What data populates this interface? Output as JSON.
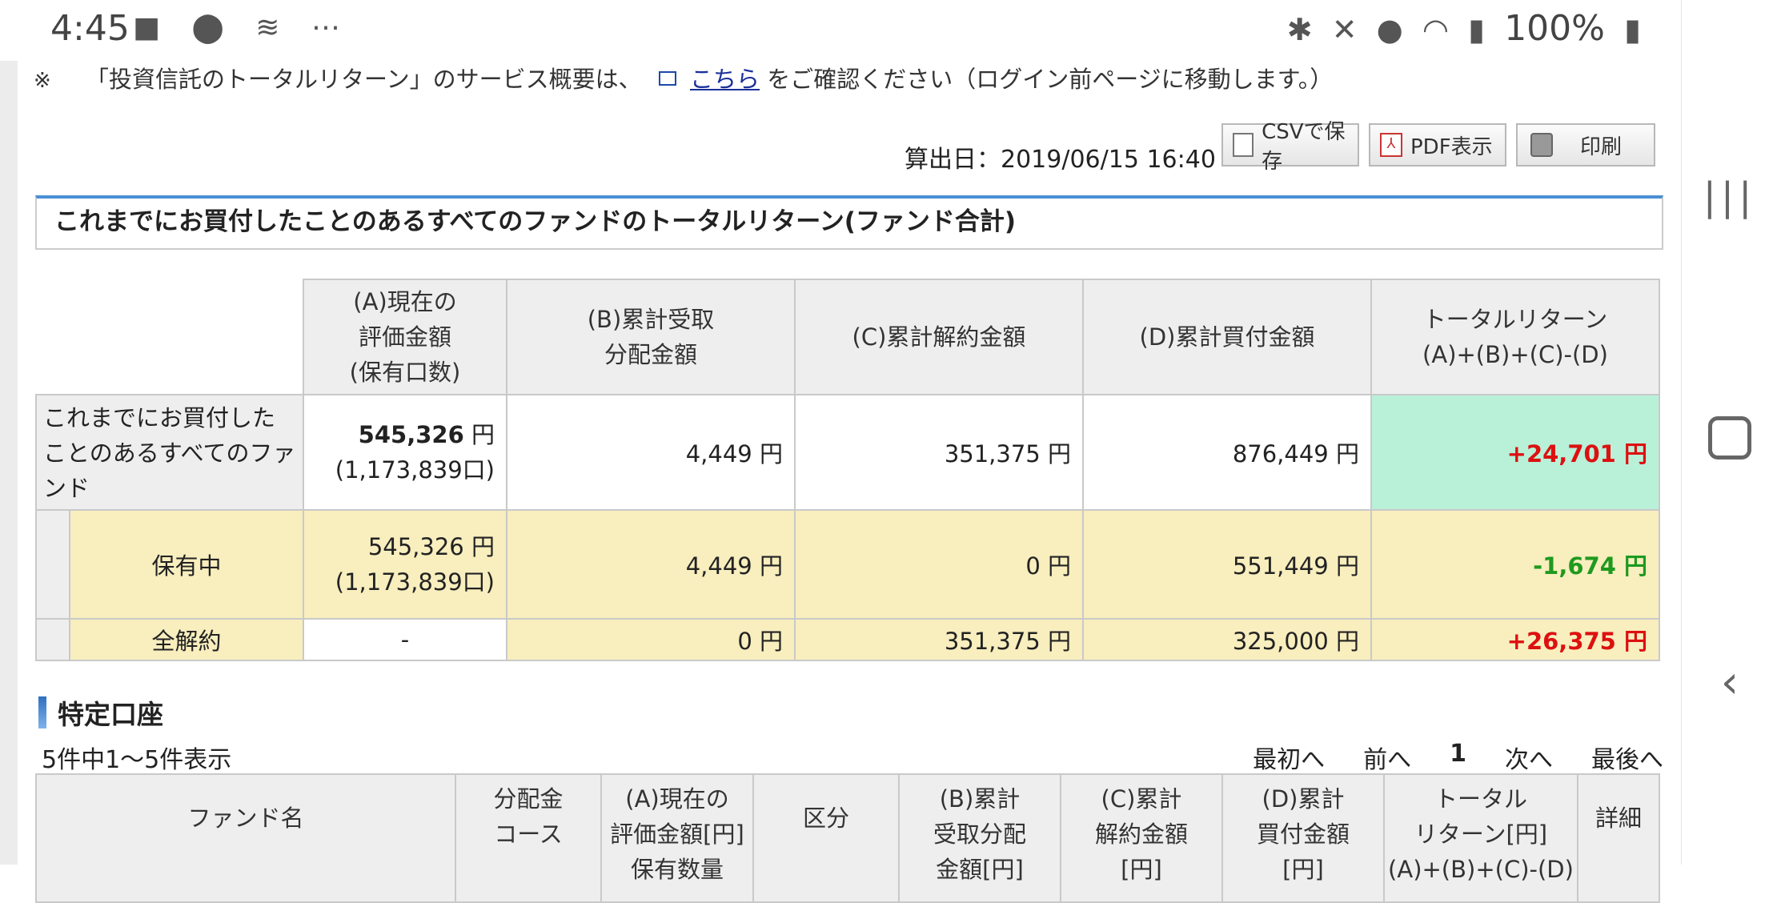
{
  "status_bar": {
    "time": "4:45",
    "left_icons": [
      "video-icon",
      "location-icon",
      "app-icon",
      "more-icon"
    ],
    "right_icons": [
      "bluetooth-icon",
      "mute-icon",
      "location-icon",
      "wifi-icon",
      "signal-icon"
    ],
    "battery": "100%"
  },
  "notice": {
    "mark": "※",
    "before": "「投資信託のトータルリターン」のサービス概要は、",
    "link": "こちら",
    "after": "をご確認ください（ログイン前ページに移動します。）"
  },
  "toolbar": {
    "calc_date": "算出日：2019/06/15 16:40",
    "csv_label": "CSVで保存",
    "pdf_label": "PDF表示",
    "print_label": "印刷"
  },
  "panel": {
    "title": "これまでにお買付したことのあるすべてのファンドのトータルリターン(ファンド合計)"
  },
  "summary": {
    "headers": [
      "(A)現在の\n評価金額\n(保有口数)",
      "(B)累計受取\n分配金額",
      "(C)累計解約金額",
      "(D)累計買付金額",
      "トータルリターン\n(A)+(B)+(C)-(D)"
    ],
    "rows": [
      {
        "label": "これまでにお買付したことのあるすべてのファンド",
        "a_value": "545,326",
        "a_units": "(1,173,839口)",
        "b": "4,449",
        "c": "351,375",
        "d": "876,449",
        "total": "+24,701"
      },
      {
        "label": "保有中",
        "a_value": "545,326",
        "a_units": "(1,173,839口)",
        "b": "4,449",
        "c": "0",
        "d": "551,449",
        "total": "-1,674"
      },
      {
        "label": "全解約",
        "a_value": "-",
        "a_units": "",
        "b": "0",
        "c": "351,375",
        "d": "325,000",
        "total": "+26,375"
      }
    ],
    "unit": "円"
  },
  "section": {
    "title": "特定口座",
    "count": "5件中1～5件表示",
    "pager": {
      "first": "最初へ",
      "prev": "前へ",
      "current": "1",
      "next": "次へ",
      "last": "最後へ"
    }
  },
  "list": {
    "headers": [
      "ファンド名",
      "分配金\nコース",
      "(A)現在の\n評価金額[円]\n保有数量",
      "区分",
      "(B)累計\n受取分配\n金額[円]",
      "(C)累計\n解約金額\n[円]",
      "(D)累計\n買付金額\n[円]",
      "トータル\nリターン[円]\n(A)+(B)+(C)-(D)",
      "詳細"
    ]
  },
  "colors": {
    "accent_blue": "#4a8fd6",
    "positive_red": "#dd1010",
    "negative_green": "#1f9a1f",
    "total_cell_green": "#b8f0d8",
    "row_yellow": "#f8eebe"
  }
}
